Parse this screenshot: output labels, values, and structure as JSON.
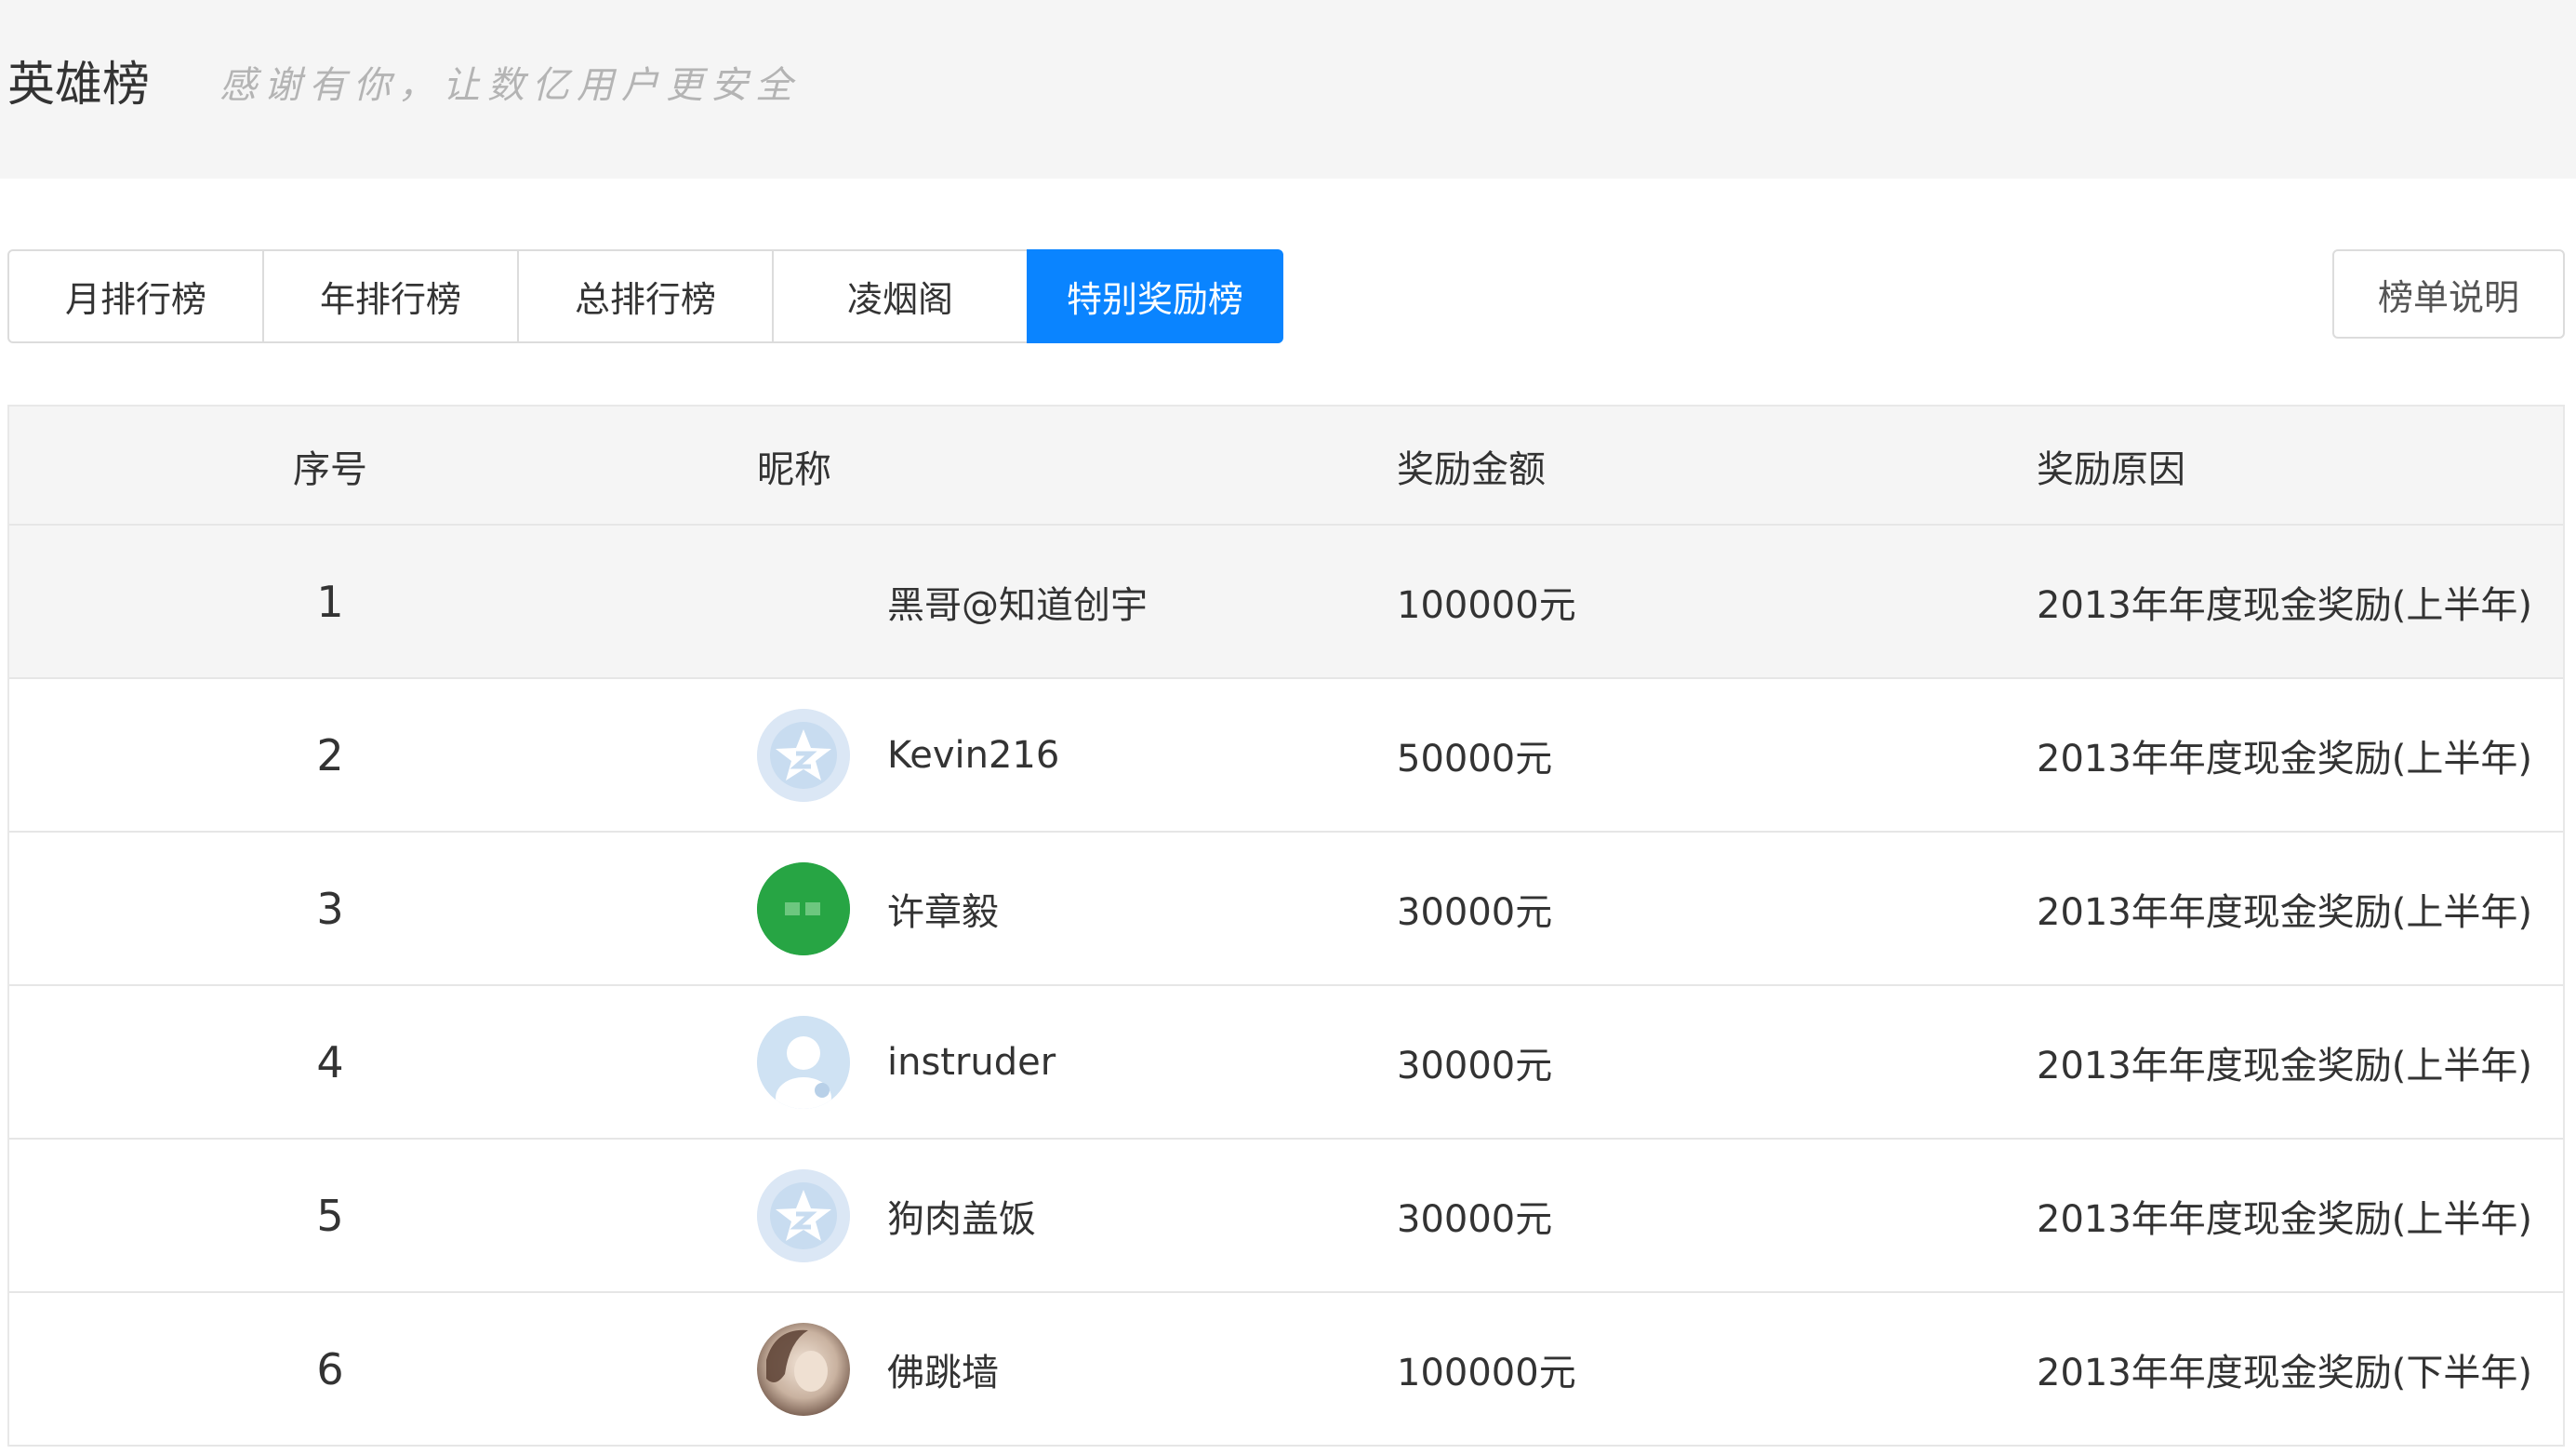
{
  "header": {
    "title": "英雄榜",
    "subtitle": "感谢有你，让数亿用户更安全"
  },
  "tabs": [
    {
      "label": "月排行榜",
      "active": false
    },
    {
      "label": "年排行榜",
      "active": false
    },
    {
      "label": "总排行榜",
      "active": false
    },
    {
      "label": "凌烟阁",
      "active": false
    },
    {
      "label": "特别奖励榜",
      "active": true
    }
  ],
  "explain_button": {
    "label": "榜单说明"
  },
  "table": {
    "headers": {
      "no": "序号",
      "nickname": "昵称",
      "amount": "奖励金额",
      "reason": "奖励原因"
    },
    "rows": [
      {
        "no": "1",
        "nickname": "黑哥@知道创宇",
        "amount": "100000元",
        "reason": "2013年年度现金奖励(上半年)",
        "avatar": "none"
      },
      {
        "no": "2",
        "nickname": "Kevin216",
        "amount": "50000元",
        "reason": "2013年年度现金奖励(上半年)",
        "avatar": "default-star-avatar"
      },
      {
        "no": "3",
        "nickname": "许章毅",
        "amount": "30000元",
        "reason": "2013年年度现金奖励(上半年)",
        "avatar": "green-avatar"
      },
      {
        "no": "4",
        "nickname": "instruder",
        "amount": "30000元",
        "reason": "2013年年度现金奖励(上半年)",
        "avatar": "default-user-avatar"
      },
      {
        "no": "5",
        "nickname": "狗肉盖饭",
        "amount": "30000元",
        "reason": "2013年年度现金奖励(上半年)",
        "avatar": "default-star-avatar"
      },
      {
        "no": "6",
        "nickname": "佛跳墙",
        "amount": "100000元",
        "reason": "2013年年度现金奖励(下半年)",
        "avatar": "photo-avatar"
      }
    ]
  },
  "colors": {
    "accent": "#0a84ff",
    "header_bg": "#f5f5f5",
    "border": "#dcdcdc",
    "text": "#333333",
    "subtitle": "#b4b4b4"
  }
}
